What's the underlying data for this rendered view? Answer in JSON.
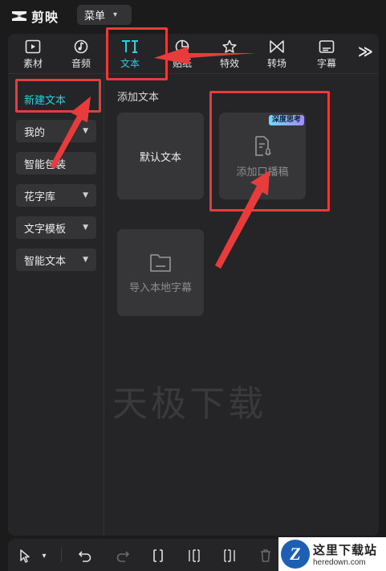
{
  "app": {
    "name": "剪映",
    "menu_label": "菜单"
  },
  "tabs": [
    {
      "label": "素材",
      "icon": "media-icon"
    },
    {
      "label": "音频",
      "icon": "music-note-icon"
    },
    {
      "label": "文本",
      "icon": "text-icon",
      "active": true
    },
    {
      "label": "贴纸",
      "icon": "sticker-icon"
    },
    {
      "label": "特效",
      "icon": "star-effect-icon"
    },
    {
      "label": "转场",
      "icon": "transition-icon"
    },
    {
      "label": "字幕",
      "icon": "subtitle-icon"
    }
  ],
  "tab_more_glyph": "≫",
  "sidebar": {
    "items": [
      {
        "label": "新建文本",
        "active": true
      },
      {
        "label": "我的",
        "has_chevron": true
      },
      {
        "label": "智能包装"
      },
      {
        "label": "花字库",
        "has_chevron": true
      },
      {
        "label": "文字模板",
        "has_chevron": true
      },
      {
        "label": "智能文本",
        "has_chevron": true
      }
    ]
  },
  "content": {
    "section_label": "添加文本",
    "cards": {
      "default_text": "默认文本",
      "add_script": "添加口播稿",
      "add_script_badge": "深度思考",
      "import_subtitle": "导入本地字幕"
    }
  },
  "watermark_text": "天极下载",
  "site_logo": {
    "mark": "Z",
    "cn": "这里下载站",
    "en": "heredown.com"
  },
  "colors": {
    "accent": "#23d3e4",
    "annotation": "#e83c3c",
    "panel": "#252527"
  }
}
